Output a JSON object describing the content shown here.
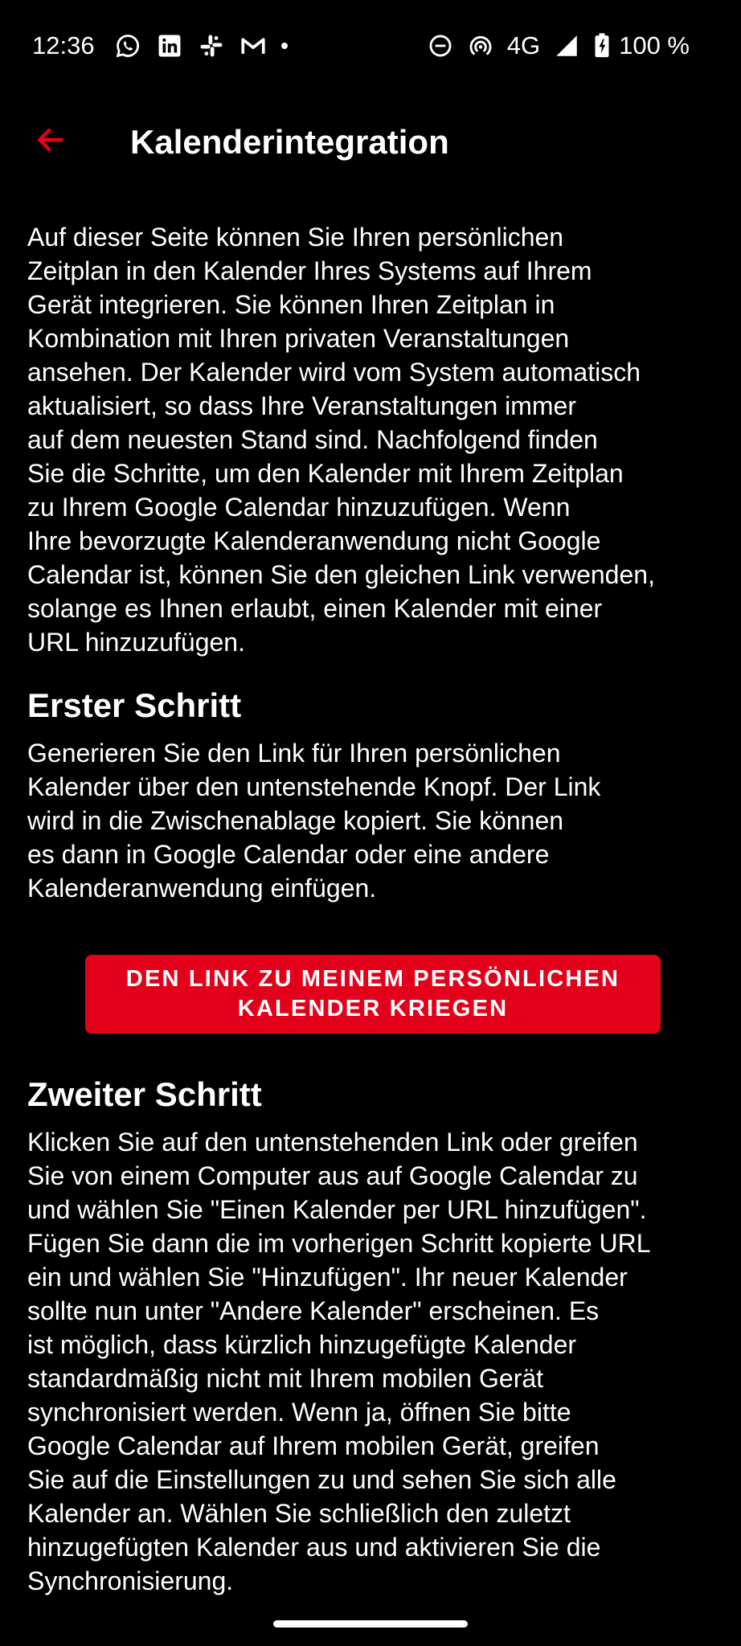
{
  "status_bar": {
    "time": "12:36",
    "left_icons": [
      "whatsapp-icon",
      "linkedin-icon",
      "slack-icon",
      "gmail-icon",
      "notification-dot-icon"
    ],
    "right_icons": [
      "do-not-disturb-icon",
      "hotspot-icon",
      "signal-icon",
      "battery-charging-icon"
    ],
    "network": "4G",
    "battery": "100 %"
  },
  "app_bar": {
    "back_icon": "arrow-back-icon",
    "title": "Kalenderintegration"
  },
  "intro": {
    "text": "Auf dieser Seite können Sie Ihren persönlichen\nZeitplan in den Kalender Ihres Systems auf Ihrem\nGerät integrieren. Sie können Ihren Zeitplan in\nKombination mit Ihren privaten Veranstaltungen\nansehen. Der Kalender wird vom System automatisch\naktualisiert, so dass Ihre Veranstaltungen immer\nauf dem neuesten Stand sind. Nachfolgend finden\nSie die Schritte, um den Kalender mit Ihrem Zeitplan\nzu Ihrem Google Calendar hinzuzufügen. Wenn\nIhre bevorzugte Kalenderanwendung nicht Google\nCalendar ist, können Sie den gleichen Link verwenden,\nsolange es Ihnen erlaubt, einen Kalender mit einer\nURL hinzuzufügen."
  },
  "step1": {
    "heading": "Erster Schritt",
    "text": "Generieren Sie den Link für Ihren persönlichen\nKalender über den untenstehende Knopf. Der Link\nwird in die Zwischenablage kopiert. Sie können\nes dann in Google Calendar oder eine andere\nKalenderanwendung einfügen.",
    "button_label": "DEN LINK ZU MEINEM PERSÖNLICHEN\nKALENDER KRIEGEN"
  },
  "step2": {
    "heading": "Zweiter Schritt",
    "text": "Klicken Sie auf den untenstehenden Link oder greifen\nSie von einem Computer aus auf Google Calendar zu\nund wählen Sie \"Einen Kalender per URL hinzufügen\".\nFügen Sie dann die im vorherigen Schritt kopierte URL\nein und wählen Sie \"Hinzufügen\". Ihr neuer Kalender\nsollte nun unter \"Andere Kalender\" erscheinen. Es\nist möglich, dass kürzlich hinzugefügte Kalender\nstandardmäßig nicht mit Ihrem mobilen Gerät\nsynchronisiert werden. Wenn ja, öffnen Sie bitte\nGoogle Calendar auf Ihrem mobilen Gerät, greifen\nSie auf die Einstellungen zu und sehen Sie sich alle\nKalender an. Wählen Sie schließlich den zuletzt\nhinzugefügten Kalender aus und aktivieren Sie die\nSynchronisierung."
  },
  "colors": {
    "background": "#000000",
    "text": "#ffffff",
    "accent": "#e3001b"
  }
}
